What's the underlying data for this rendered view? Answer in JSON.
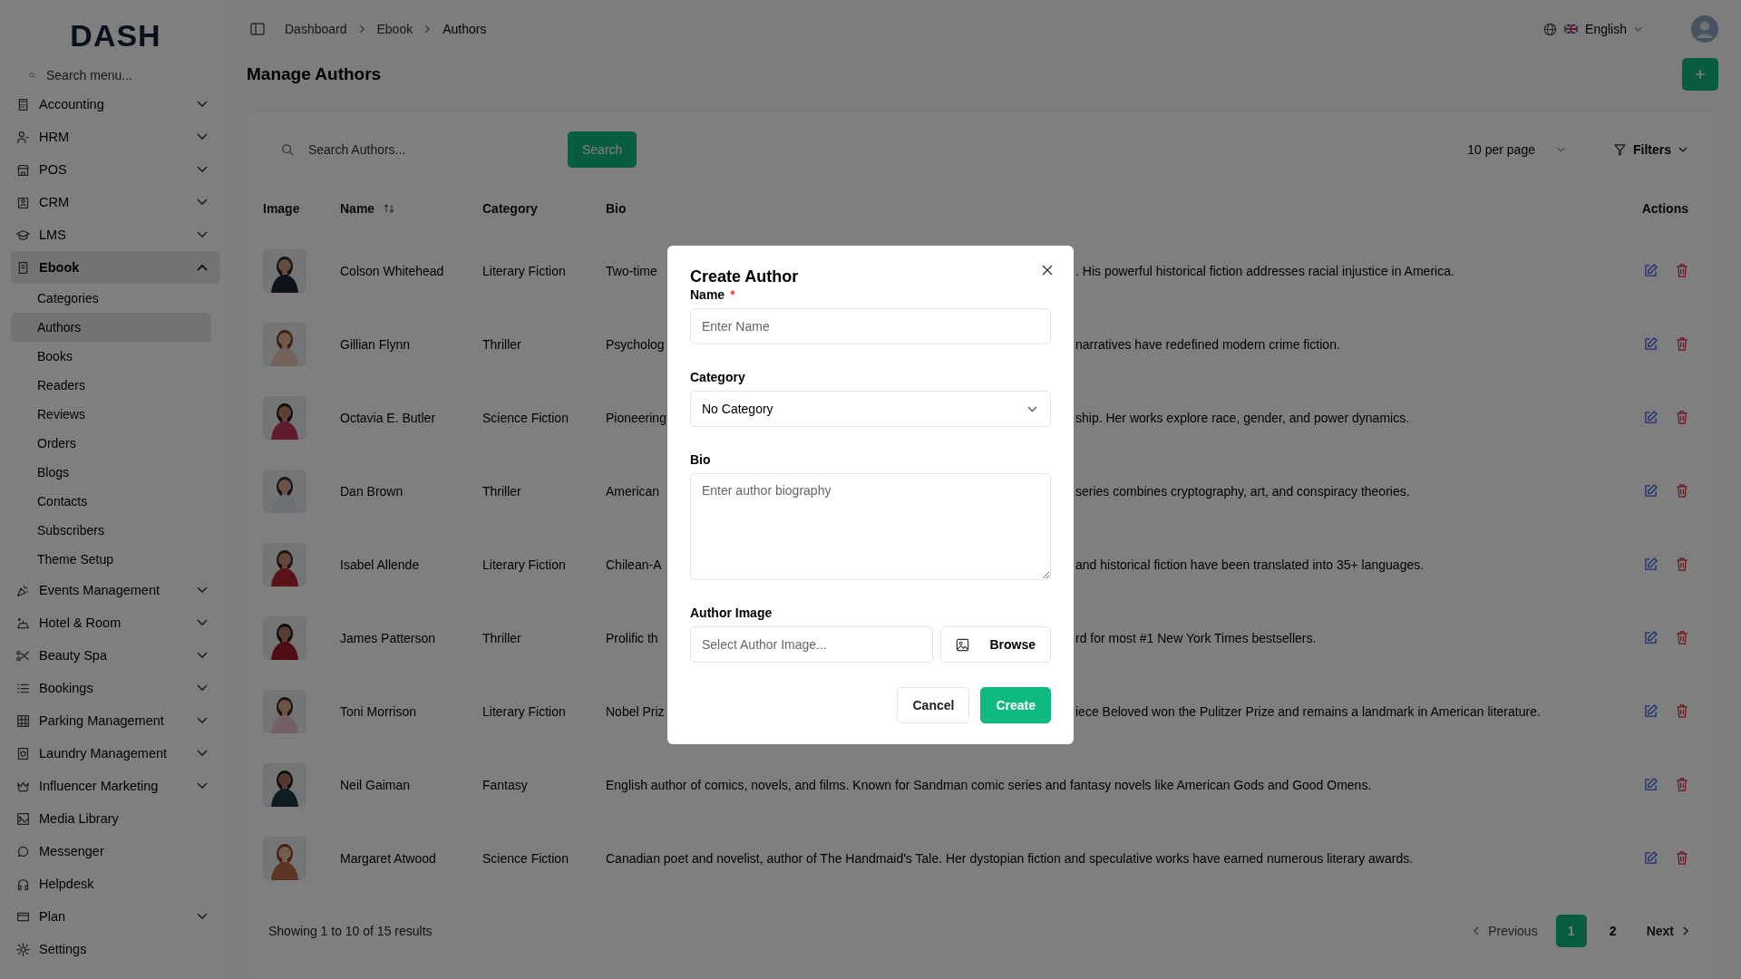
{
  "sidebar": {
    "logo": "DASH",
    "search_placeholder": "Search menu...",
    "items": [
      {
        "label": "Accounting",
        "expandable": true,
        "expanded": false,
        "selected": false
      },
      {
        "label": "HRM",
        "expandable": true,
        "expanded": false,
        "selected": false
      },
      {
        "label": "POS",
        "expandable": true,
        "expanded": false,
        "selected": false
      },
      {
        "label": "CRM",
        "expandable": true,
        "expanded": false,
        "selected": false
      },
      {
        "label": "LMS",
        "expandable": true,
        "expanded": false,
        "selected": false
      },
      {
        "label": "Ebook",
        "expandable": true,
        "expanded": true,
        "selected": true,
        "children": [
          {
            "label": "Categories",
            "selected": false
          },
          {
            "label": "Authors",
            "selected": true
          },
          {
            "label": "Books",
            "selected": false
          },
          {
            "label": "Readers",
            "selected": false
          },
          {
            "label": "Reviews",
            "selected": false
          },
          {
            "label": "Orders",
            "selected": false
          },
          {
            "label": "Blogs",
            "selected": false
          },
          {
            "label": "Contacts",
            "selected": false
          },
          {
            "label": "Subscribers",
            "selected": false
          },
          {
            "label": "Theme Setup",
            "selected": false
          }
        ]
      },
      {
        "label": "Events Management",
        "expandable": true,
        "expanded": false,
        "selected": false
      },
      {
        "label": "Hotel & Room",
        "expandable": true,
        "expanded": false,
        "selected": false
      },
      {
        "label": "Beauty Spa",
        "expandable": true,
        "expanded": false,
        "selected": false
      },
      {
        "label": "Bookings",
        "expandable": true,
        "expanded": false,
        "selected": false
      },
      {
        "label": "Parking Management",
        "expandable": true,
        "expanded": false,
        "selected": false
      },
      {
        "label": "Laundry Management",
        "expandable": true,
        "expanded": false,
        "selected": false
      },
      {
        "label": "Influencer Marketing",
        "expandable": true,
        "expanded": false,
        "selected": false
      },
      {
        "label": "Media Library",
        "expandable": false,
        "selected": false
      },
      {
        "label": "Messenger",
        "expandable": false,
        "selected": false
      },
      {
        "label": "Helpdesk",
        "expandable": false,
        "selected": false
      },
      {
        "label": "Plan",
        "expandable": true,
        "expanded": false,
        "selected": false
      },
      {
        "label": "Settings",
        "expandable": false,
        "selected": false
      }
    ]
  },
  "header": {
    "breadcrumbs": [
      "Dashboard",
      "Ebook",
      "Authors"
    ],
    "language": "English"
  },
  "page_title": "Manage Authors",
  "toolbar": {
    "search_placeholder": "Search Authors...",
    "search_button": "Search",
    "per_page": "10 per page",
    "filters": "Filters"
  },
  "table": {
    "columns": [
      {
        "label": "Image",
        "sortable": false
      },
      {
        "label": "Name",
        "sortable": true
      },
      {
        "label": "Category",
        "sortable": false
      },
      {
        "label": "Bio",
        "sortable": false
      },
      {
        "label": "Actions",
        "sortable": false
      }
    ],
    "rows": [
      {
        "name": "Colson Whitehead",
        "category": "Literary Fiction",
        "bio_start": "Two-time",
        "bio_end": ". His powerful historical fiction addresses racial injustice in America."
      },
      {
        "name": "Gillian Flynn",
        "category": "Thriller",
        "bio_start": "Psycholog",
        "bio_end": "narratives have redefined modern crime fiction."
      },
      {
        "name": "Octavia E. Butler",
        "category": "Science Fiction",
        "bio_start": "Pioneering",
        "bio_end": "ship. Her works explore race, gender, and power dynamics."
      },
      {
        "name": "Dan Brown",
        "category": "Thriller",
        "bio_start": "American",
        "bio_end": "series combines cryptography, art, and conspiracy theories."
      },
      {
        "name": "Isabel Allende",
        "category": "Literary Fiction",
        "bio_start": "Chilean-A",
        "bio_end": "and historical fiction have been translated into 35+ languages."
      },
      {
        "name": "James Patterson",
        "category": "Thriller",
        "bio_start": "Prolific th",
        "bio_end": "rd for most #1 New York Times bestsellers."
      },
      {
        "name": "Toni Morrison",
        "category": "Literary Fiction",
        "bio_start": "Nobel Priz",
        "bio_end": "iece Beloved won the Pulitzer Prize and remains a landmark in American literature."
      },
      {
        "name": "Neil Gaiman",
        "category": "Fantasy",
        "bio": "English author of comics, novels, and films. Known for Sandman comic series and fantasy novels like American Gods and Good Omens."
      },
      {
        "name": "Margaret Atwood",
        "category": "Science Fiction",
        "bio": "Canadian poet and novelist, author of The Handmaid's Tale. Her dystopian fiction and speculative works have earned numerous literary awards."
      }
    ]
  },
  "pagination": {
    "summary": "Showing 1 to 10 of 15 results",
    "previous": "Previous",
    "pages": [
      {
        "label": "1",
        "selected": true
      },
      {
        "label": "2",
        "selected": false
      }
    ],
    "next": "Next"
  },
  "modal": {
    "title": "Create Author",
    "fields": [
      {
        "kind": "text",
        "label": "Name",
        "required_marker": "*",
        "placeholder": "Enter Name"
      },
      {
        "kind": "select",
        "label": "Category",
        "value": "No Category"
      },
      {
        "kind": "textarea",
        "label": "Bio",
        "placeholder": "Enter author biography"
      },
      {
        "kind": "file",
        "label": "Author Image",
        "placeholder": "Select Author Image...",
        "button": "Browse"
      }
    ],
    "buttons": [
      {
        "label": "Cancel",
        "kind": "secondary"
      },
      {
        "label": "Create",
        "kind": "primary"
      }
    ]
  }
}
